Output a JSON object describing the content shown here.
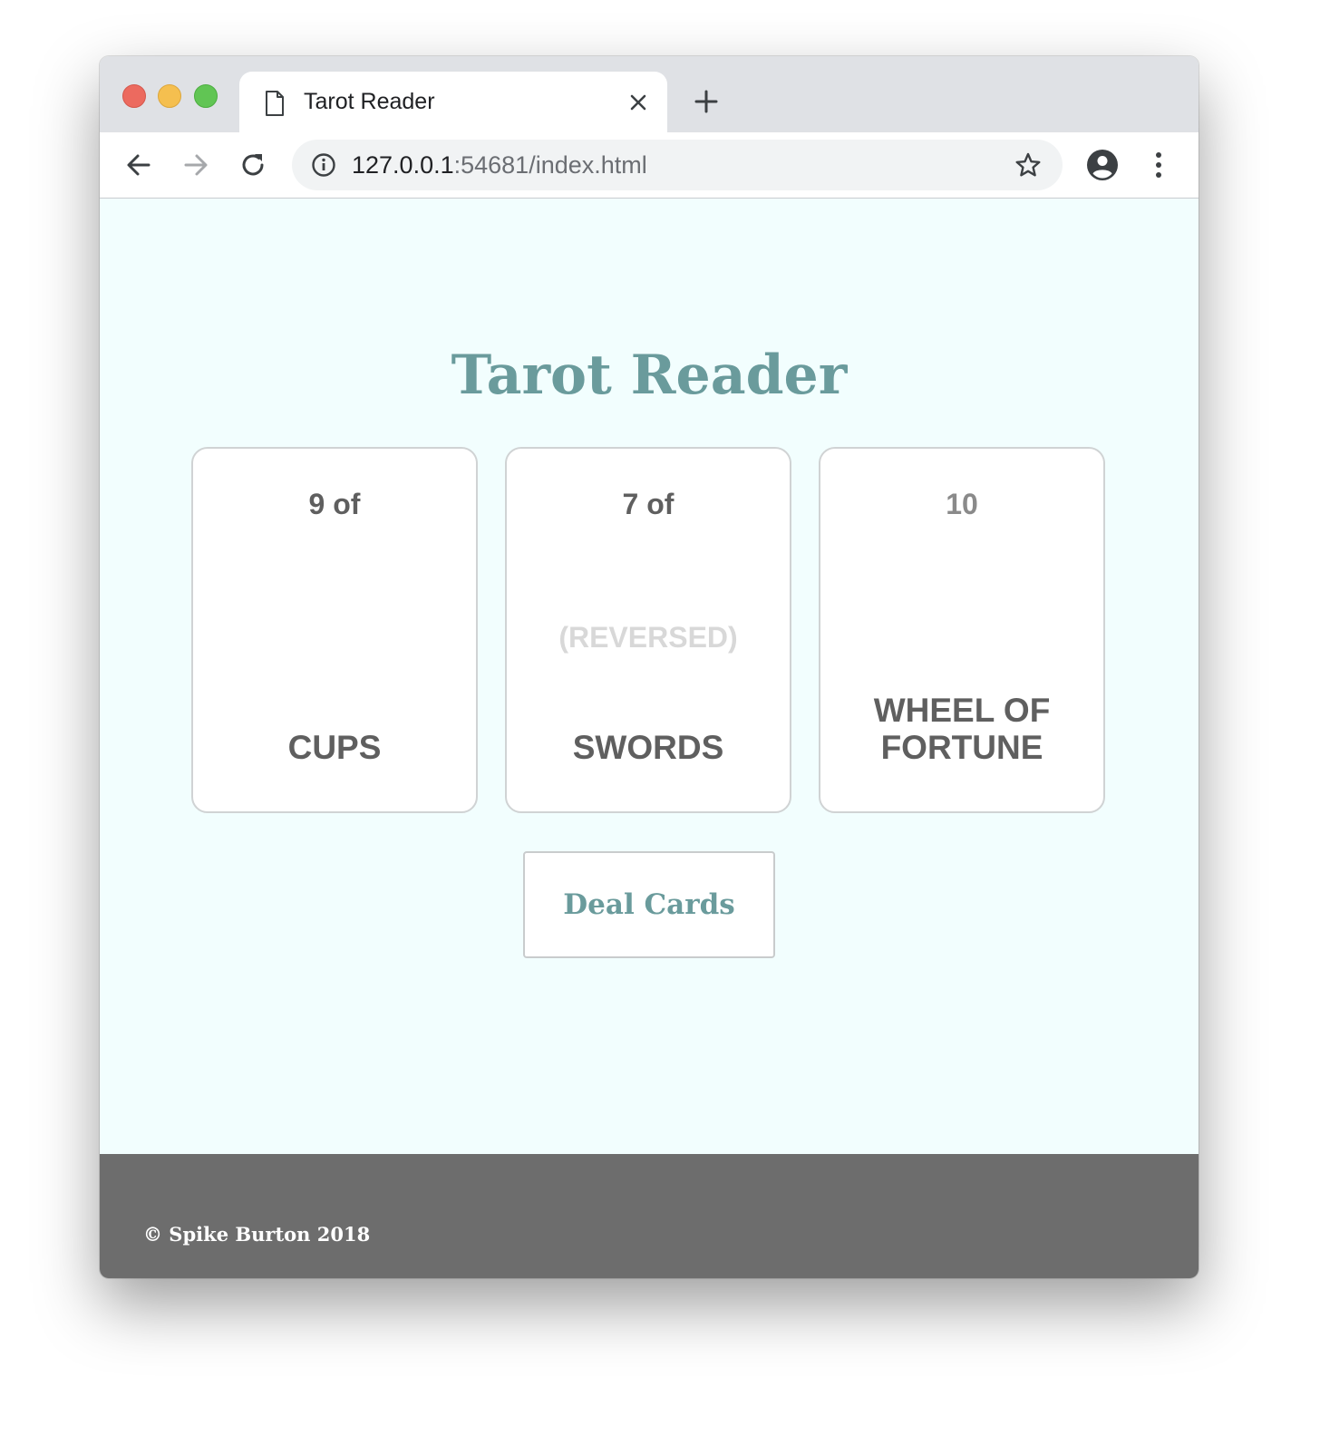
{
  "browser": {
    "tab_title": "Tarot Reader",
    "url_host": "127.0.0.1",
    "url_rest": ":54681/index.html",
    "icons": {
      "page": "document-icon",
      "close": "close-icon",
      "new_tab": "plus-icon",
      "back": "arrow-left-icon",
      "forward": "arrow-right-icon",
      "reload": "reload-icon",
      "info": "info-icon",
      "bookmark": "star-icon",
      "profile": "account-icon",
      "menu": "kebab-menu-icon"
    }
  },
  "page": {
    "title": "Tarot Reader",
    "cards": [
      {
        "rank": "9 of",
        "reversed": "",
        "suit": "CUPS"
      },
      {
        "rank": "7 of",
        "reversed": "(REVERSED)",
        "suit": "SWORDS"
      },
      {
        "rank": "10",
        "reversed": "",
        "suit": "WHEEL OF FORTUNE"
      }
    ],
    "deal_button_label": "Deal Cards"
  },
  "footer": {
    "text": "© Spike Burton 2018"
  },
  "colors": {
    "page_background": "#f2fefe",
    "accent_teal": "#6a9b9c",
    "card_text": "#5f5f5f",
    "reversed_text": "#d8d8d8",
    "footer_background": "#6d6d6d"
  }
}
